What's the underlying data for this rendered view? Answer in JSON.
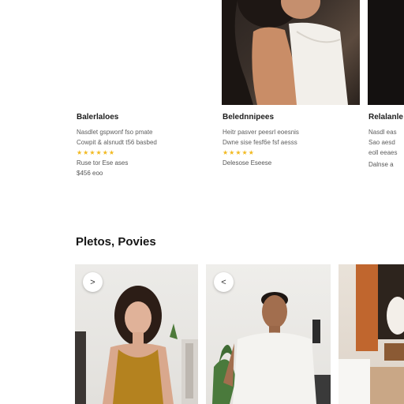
{
  "top_cards": [
    {
      "title": "Balerlaloes",
      "lines": [
        "Nasdlet gspwonf fso pmate",
        "Cowpit & alsnudt t56 basbed"
      ],
      "rating": 5,
      "meta_lines": [
        "Ruse tor Ese ases",
        "$456 eoo"
      ]
    },
    {
      "title": "Belednnipees",
      "lines": [
        "Heitr pasver peesrl eoesnis",
        "Dwne sise fesf6e fsf aesss"
      ],
      "rating": 5,
      "meta_lines": [
        "Delesose Eseese"
      ]
    },
    {
      "title": "Relalanle",
      "lines": [
        "Nasdl eas",
        "Sao aesd",
        "eoll eeaes"
      ],
      "rating": 0,
      "meta_lines": [
        "Dalnse a"
      ]
    }
  ],
  "section": {
    "heading": "Pletos, Povies"
  },
  "gallery": {
    "prev_icon_glyph": ">",
    "next_icon_glyph": "<"
  },
  "colors": {
    "star": "#f2b91f",
    "background": "#ffffff"
  },
  "icons": [
    "chevron-right-icon",
    "chevron-left-icon",
    "star-icon"
  ]
}
